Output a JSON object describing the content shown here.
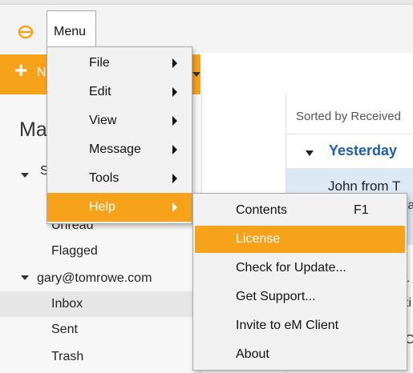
{
  "menubar": {
    "menu_label": "Menu"
  },
  "toolbar": {
    "new_label": "N"
  },
  "sidebar": {
    "heading": "Ma",
    "section_fragment": "S",
    "account": "gary@tomrowe.com",
    "folders_smart": [
      "Unread",
      "Flagged"
    ],
    "folders_account": [
      "Inbox",
      "Sent",
      "Trash"
    ]
  },
  "message_list": {
    "sort_label": "Sorted by Received",
    "group": "Yesterday",
    "sender": "John from T",
    "fragments": [
      "la",
      "r",
      "ti",
      "C",
      "i"
    ]
  },
  "main_menu": {
    "items": [
      {
        "label": "File"
      },
      {
        "label": "Edit"
      },
      {
        "label": "View"
      },
      {
        "label": "Message"
      },
      {
        "label": "Tools"
      },
      {
        "label": "Help"
      }
    ]
  },
  "help_menu": {
    "items": [
      {
        "label": "Contents",
        "shortcut": "F1"
      },
      {
        "label": "License"
      },
      {
        "label": "Check for Update..."
      },
      {
        "label": "Get Support..."
      },
      {
        "label": "Invite to eM Client"
      },
      {
        "label": "About"
      }
    ]
  },
  "colors": {
    "accent": "#f7a21b",
    "group_blue": "#1e5ea8",
    "selection": "#dde8f5"
  },
  "icons": [
    "em-client-logo-icon",
    "plus-icon",
    "submenu-arrow-icon",
    "tree-caret-icon"
  ]
}
